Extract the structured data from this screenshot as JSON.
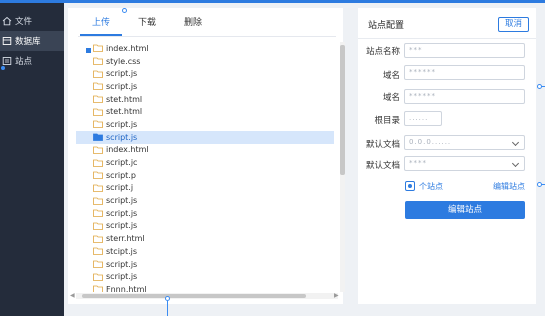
{
  "colors": {
    "accent": "#2d7be0",
    "sidebar_bg": "#242c3b",
    "selected_row": "#d6e6fb"
  },
  "sidebar": {
    "items": [
      {
        "label": "文件",
        "icon": "home-icon"
      },
      {
        "label": "数据库",
        "icon": "database-icon"
      },
      {
        "label": "站点",
        "icon": "site-icon"
      }
    ]
  },
  "file_panel": {
    "tabs": [
      {
        "label": "上传"
      },
      {
        "label": "下载"
      },
      {
        "label": "删除"
      }
    ],
    "active_tab": 0,
    "tree": [
      {
        "name": "index.html",
        "root": true
      },
      {
        "name": "style.css"
      },
      {
        "name": "script.js"
      },
      {
        "name": "script.js"
      },
      {
        "name": "stet.html"
      },
      {
        "name": "stet.html"
      },
      {
        "name": "script.js"
      },
      {
        "name": "script.js",
        "selected": true
      },
      {
        "name": "index.html"
      },
      {
        "name": "script.jc"
      },
      {
        "name": "script.p"
      },
      {
        "name": "script.j"
      },
      {
        "name": "script.js"
      },
      {
        "name": "script.js"
      },
      {
        "name": "script.js"
      },
      {
        "name": "sterr.html"
      },
      {
        "name": "stcipt.js"
      },
      {
        "name": "script.js"
      },
      {
        "name": "script.js"
      },
      {
        "name": "Fnnn.html"
      }
    ]
  },
  "config": {
    "title": "站点配置",
    "cancel_label": "取消",
    "fields": [
      {
        "label": "站点名称",
        "value": "***"
      },
      {
        "label": "域名",
        "value": "******"
      },
      {
        "label": "域名",
        "value": "******"
      },
      {
        "label": "根目录",
        "value": "......"
      },
      {
        "label": "默认文档",
        "value": "0.0.0......"
      },
      {
        "label": "默认文档",
        "value": "****"
      }
    ],
    "checkbox_label": "个站点",
    "edit_link": "编辑站点",
    "primary_button": "编辑站点"
  }
}
